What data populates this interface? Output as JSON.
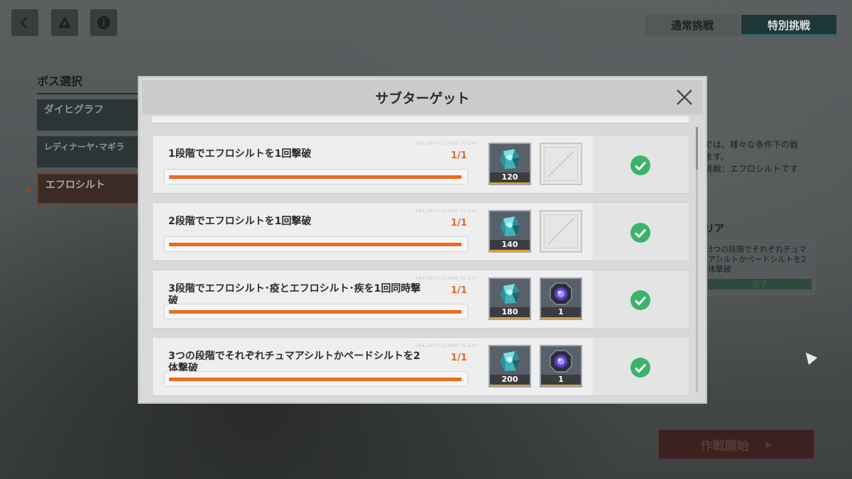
{
  "background": {
    "mode_tabs": [
      {
        "label": "通常挑戦",
        "active": false
      },
      {
        "label": "特別挑戦",
        "active": true
      }
    ],
    "boss_section_title": "ボス選択",
    "boss_list": [
      {
        "label": "ダイヒグラフ",
        "active": false
      },
      {
        "label": "レディナーヤ･マギラ",
        "active": false
      },
      {
        "label": "エフロシルト",
        "active": true
      }
    ],
    "description_lines": [
      "では、様々な条件下の戦",
      "ます。",
      "挑戦：エフロシルトです"
    ],
    "clear_title": "リア",
    "clear_condition": "3つの段階でそれぞれチュマアシルトかペードシルトを2体撃破",
    "clear_status": "完了",
    "start_button": "作戦開始"
  },
  "modal": {
    "title": "サブターゲット",
    "close_icon": "close-icon"
  },
  "colors": {
    "accent": "#ee6b1e",
    "check": "#3bb36a",
    "reward_bar": "#e3a125"
  },
  "subtargets": [
    {
      "title": "1段階でエフロシルトを1回撃破",
      "count": "1/1",
      "progress": 1.0,
      "serial": "284-2847-21-898-75-234",
      "rewards": [
        {
          "icon": "crystal-icon",
          "qty": "120"
        },
        {
          "icon": "empty-slot",
          "qty": ""
        }
      ],
      "completed": true
    },
    {
      "title": "2段階でエフロシルトを1回撃破",
      "count": "1/1",
      "progress": 1.0,
      "serial": "284-2847-21-898-75-234",
      "rewards": [
        {
          "icon": "crystal-icon",
          "qty": "140"
        },
        {
          "icon": "empty-slot",
          "qty": ""
        }
      ],
      "completed": true
    },
    {
      "title": "3段階でエフロシルト･疫とエフロシルト･疾を1回同時撃破",
      "count": "1/1",
      "progress": 1.0,
      "serial": "284-2847-21-898-75-234",
      "rewards": [
        {
          "icon": "crystal-icon",
          "qty": "180"
        },
        {
          "icon": "core-icon",
          "qty": "1"
        }
      ],
      "completed": true
    },
    {
      "title": "3つの段階でそれぞれチュマアシルトかペードシルトを2体撃破",
      "count": "1/1",
      "progress": 1.0,
      "serial": "284-2847-21-898-75-234",
      "rewards": [
        {
          "icon": "crystal-icon",
          "qty": "200"
        },
        {
          "icon": "core-icon",
          "qty": "1"
        }
      ],
      "completed": true
    }
  ]
}
